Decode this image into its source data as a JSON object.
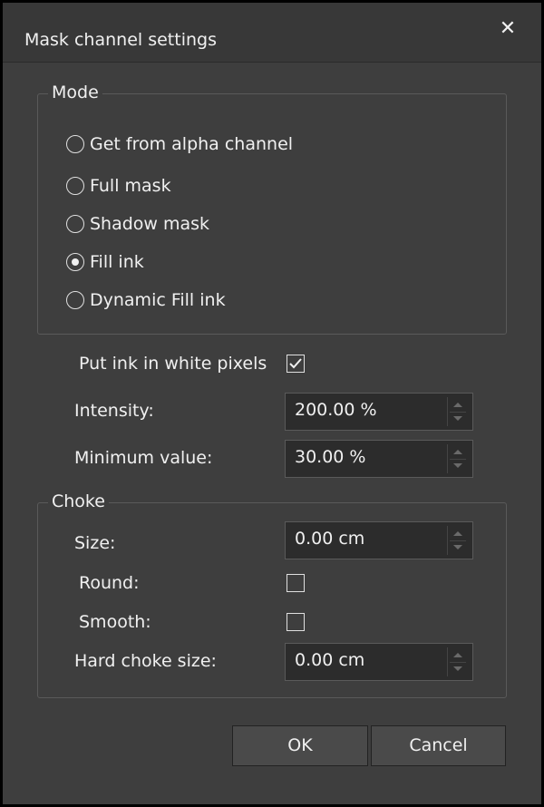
{
  "window": {
    "title": "Mask channel settings",
    "close_glyph": "✕"
  },
  "mode": {
    "label": "Mode",
    "options": [
      {
        "label": "Get from alpha channel",
        "checked": false
      },
      {
        "label": "Full mask",
        "checked": false
      },
      {
        "label": "Shadow mask",
        "checked": false
      },
      {
        "label": "Fill ink",
        "checked": true
      },
      {
        "label": "Dynamic Fill ink",
        "checked": false
      }
    ]
  },
  "put_ink": {
    "label": "Put ink in white pixels",
    "checked": true
  },
  "intensity": {
    "label": "Intensity:",
    "value": "200.00 %"
  },
  "minimum": {
    "label": "Minimum value:",
    "value": "30.00 %"
  },
  "choke": {
    "label": "Choke",
    "size": {
      "label": "Size:",
      "value": "0.00 cm"
    },
    "round": {
      "label": "Round:",
      "checked": false
    },
    "smooth": {
      "label": "Smooth:",
      "checked": false
    },
    "hard_choke": {
      "label": "Hard choke size:",
      "value": "0.00 cm"
    }
  },
  "buttons": {
    "ok": "OK",
    "cancel": "Cancel"
  }
}
